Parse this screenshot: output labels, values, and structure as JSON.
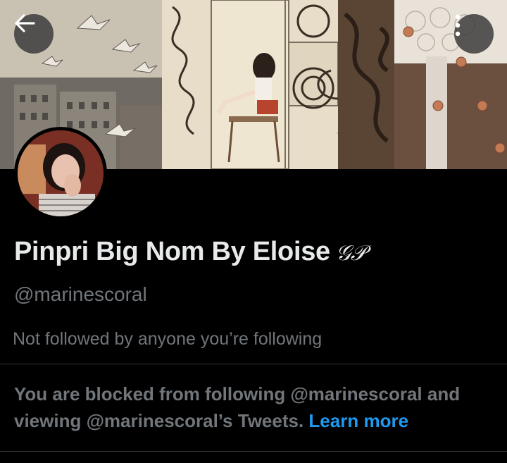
{
  "header": {
    "back_icon": "arrow-left-icon",
    "more_icon": "more-vertical-icon"
  },
  "profile": {
    "display_name": "Pinpri Big Nom By Eloise",
    "name_badge": "𝒢𝒫",
    "handle": "@marinescoral",
    "followers_note": "Not followed by anyone you’re following"
  },
  "blocked": {
    "message": "You are blocked from following @marinescoral and viewing @marinescoral’s Tweets.",
    "link_text": "Learn more"
  },
  "colors": {
    "background": "#000000",
    "text_primary": "#e7e9ea",
    "text_secondary": "#71767b",
    "link": "#1d9bf0",
    "divider": "#2f3336"
  }
}
